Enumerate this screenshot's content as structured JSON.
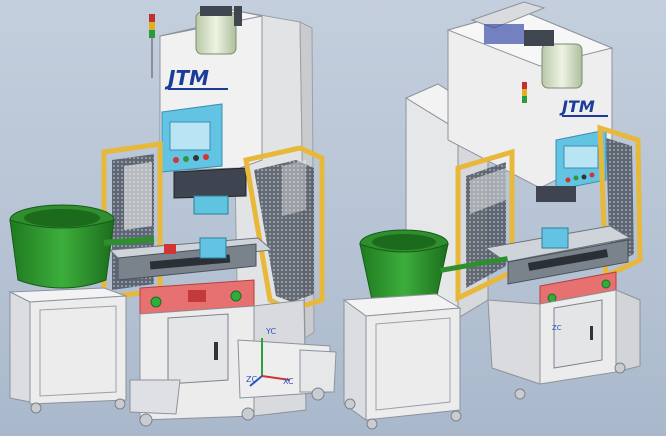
{
  "scene": {
    "left_machine": {
      "brand_logo": "JTM",
      "axis_labels": {
        "y": "YC",
        "x": "XC",
        "z": "ZC"
      }
    },
    "right_machine": {
      "brand_logo": "JTM",
      "axis_labels": {
        "z": "ZC"
      }
    }
  },
  "colors": {
    "background": "#b9c6d6",
    "frame_white": "#eeeeee",
    "guard_yellow": "#e8b83a",
    "bowl_green": "#2f9a2f",
    "panel_blue": "#6ec6e6",
    "control_red": "#e76b6b",
    "cylinder_green": "#d9e6c8",
    "steel_gray": "#9aa3ad"
  }
}
